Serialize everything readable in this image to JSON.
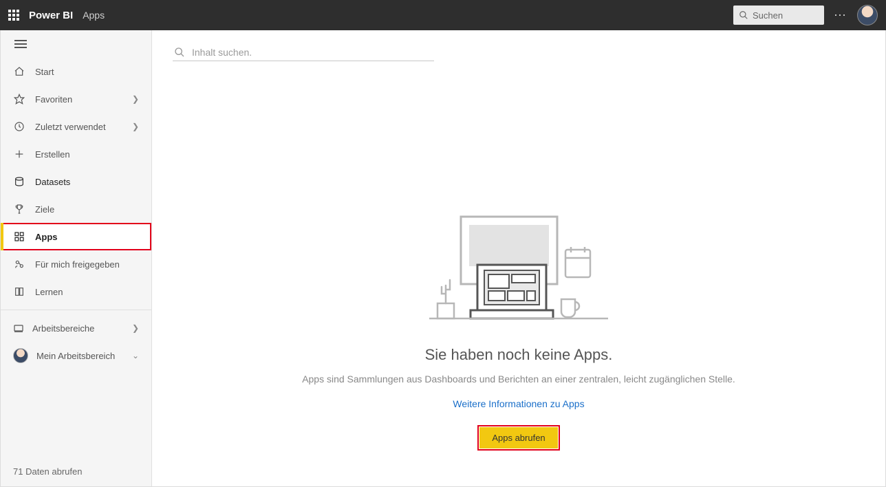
{
  "header": {
    "brand": "Power BI",
    "breadcrumb": "Apps",
    "search_placeholder": "Suchen"
  },
  "sidebar": {
    "items": [
      {
        "icon": "home",
        "label": "Start"
      },
      {
        "icon": "star",
        "label": "Favoriten",
        "chevron": true
      },
      {
        "icon": "clock",
        "label": "Zuletzt verwendet",
        "chevron": true
      },
      {
        "icon": "plus",
        "label": "Erstellen"
      },
      {
        "icon": "drum",
        "label": "Datasets",
        "strong": true
      },
      {
        "icon": "trophy",
        "label": "Ziele"
      },
      {
        "icon": "apps",
        "label": "Apps",
        "active": true,
        "highlight": true
      },
      {
        "icon": "share",
        "label": "Für mich freigegeben"
      },
      {
        "icon": "book",
        "label": "Lernen"
      }
    ],
    "workspaces_label": "Arbeitsbereiche",
    "my_workspace_label": "Mein Arbeitsbereich",
    "footer_label": "71 Daten abrufen"
  },
  "main": {
    "filter_placeholder": "Inhalt suchen.",
    "empty_title": "Sie haben noch keine Apps.",
    "empty_subtitle": "Apps sind Sammlungen aus Dashboards und Berichten an einer zentralen, leicht zugänglichen Stelle.",
    "empty_link": "Weitere Informationen zu Apps",
    "cta_label": "Apps abrufen"
  }
}
